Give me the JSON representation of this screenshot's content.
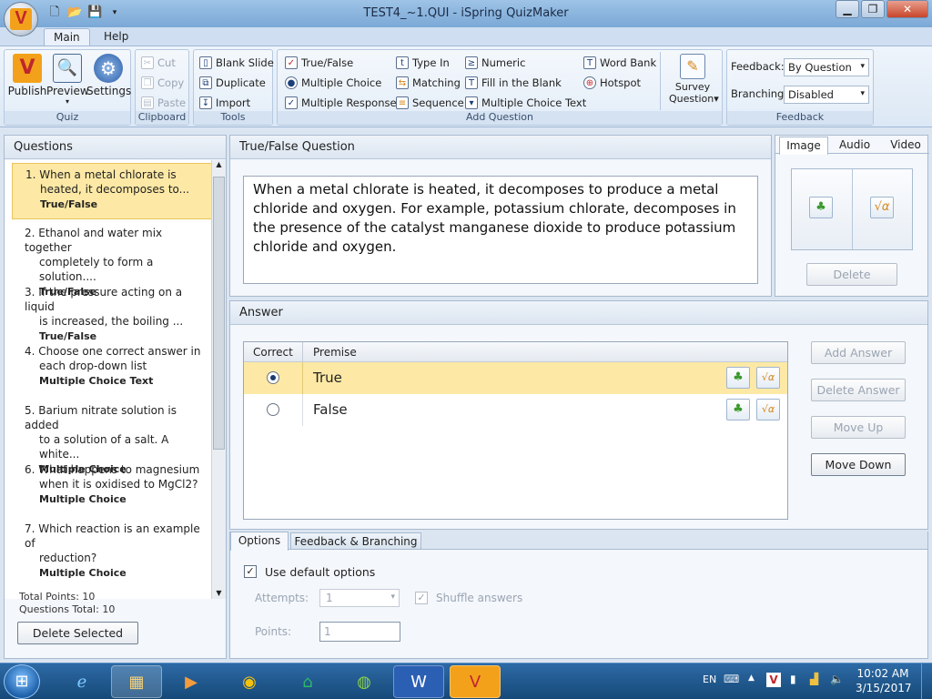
{
  "window": {
    "title": "TEST4_~1.QUI - iSpring QuizMaker"
  },
  "tabs": [
    "Main",
    "Help"
  ],
  "ribbon": {
    "quiz": {
      "label": "Quiz",
      "publish": "Publish",
      "preview": "Preview",
      "settings": "Settings"
    },
    "clipboard": {
      "label": "Clipboard",
      "cut": "Cut",
      "copy": "Copy",
      "paste": "Paste"
    },
    "tools": {
      "label": "Tools",
      "blank_slide": "Blank Slide",
      "duplicate": "Duplicate",
      "import": "Import"
    },
    "add_question": {
      "label": "Add Question",
      "true_false": "True/False",
      "multiple_choice": "Multiple Choice",
      "multiple_response": "Multiple Response",
      "type_in": "Type In",
      "matching": "Matching",
      "sequence": "Sequence",
      "numeric": "Numeric",
      "fill_blank": "Fill in the Blank",
      "mc_text": "Multiple Choice Text",
      "word_bank": "Word Bank",
      "hotspot": "Hotspot",
      "survey": "Survey",
      "survey2": "Question"
    },
    "feedback": {
      "label": "Feedback",
      "feedback_label": "Feedback:",
      "feedback_value": "By Question",
      "branching_label": "Branching:",
      "branching_value": "Disabled"
    }
  },
  "questions_pane": {
    "title": "Questions",
    "items": [
      {
        "num": "1.",
        "line1": "When a metal chlorate is",
        "line2": "heated, it decomposes to...",
        "type": "True/False"
      },
      {
        "num": "2.",
        "line1": "Ethanol and water mix together",
        "line2": "completely to form a solution....",
        "type": "True/False"
      },
      {
        "num": "3.",
        "line1": "If the pressure acting on a liquid",
        "line2": "is increased, the boiling ...",
        "type": "True/False"
      },
      {
        "num": "4.",
        "line1": "Choose one correct answer in",
        "line2": "each drop-down list",
        "type": "Multiple Choice Text"
      },
      {
        "num": "5.",
        "line1": "Barium nitrate solution is added",
        "line2": "to a solution of a salt. A white...",
        "type": "Multiple Choice"
      },
      {
        "num": "6.",
        "line1": "What happens to magnesium",
        "line2": "when it is oxidised to MgCl2?",
        "type": "Multiple Choice"
      },
      {
        "num": "7.",
        "line1": "Which reaction is an example of",
        "line2": "reduction?",
        "type": "Multiple Choice"
      }
    ],
    "total_points": "Total Points: 10",
    "questions_total": "Questions Total: 10",
    "delete_selected": "Delete Selected"
  },
  "question": {
    "title": "True/False Question",
    "text": "When a metal chlorate is heated, it decomposes to produce a metal chloride and oxygen. For example, potassium chlorate, decomposes in the presence of the catalyst manganese dioxide to produce potassium chloride and oxygen."
  },
  "media": {
    "tabs": [
      "Image",
      "Audio",
      "Video"
    ],
    "delete": "Delete"
  },
  "answer": {
    "title": "Answer",
    "col_correct": "Correct",
    "col_premise": "Premise",
    "rows": [
      {
        "text": "True",
        "selected": true
      },
      {
        "text": "False",
        "selected": false
      }
    ],
    "buttons": {
      "add": "Add Answer",
      "delete": "Delete Answer",
      "up": "Move Up",
      "down": "Move Down"
    }
  },
  "options": {
    "tabs": [
      "Options",
      "Feedback & Branching"
    ],
    "use_default": "Use default options",
    "attempts_label": "Attempts:",
    "attempts_value": "1",
    "shuffle": "Shuffle answers",
    "points_label": "Points:",
    "points_value": "1"
  },
  "taskbar": {
    "lang": "EN",
    "time": "10:02 AM",
    "date": "3/15/2017"
  },
  "colors": {
    "selection": "#fde9a5",
    "accent": "#f3a11b",
    "taskbar": "#1d578f"
  }
}
